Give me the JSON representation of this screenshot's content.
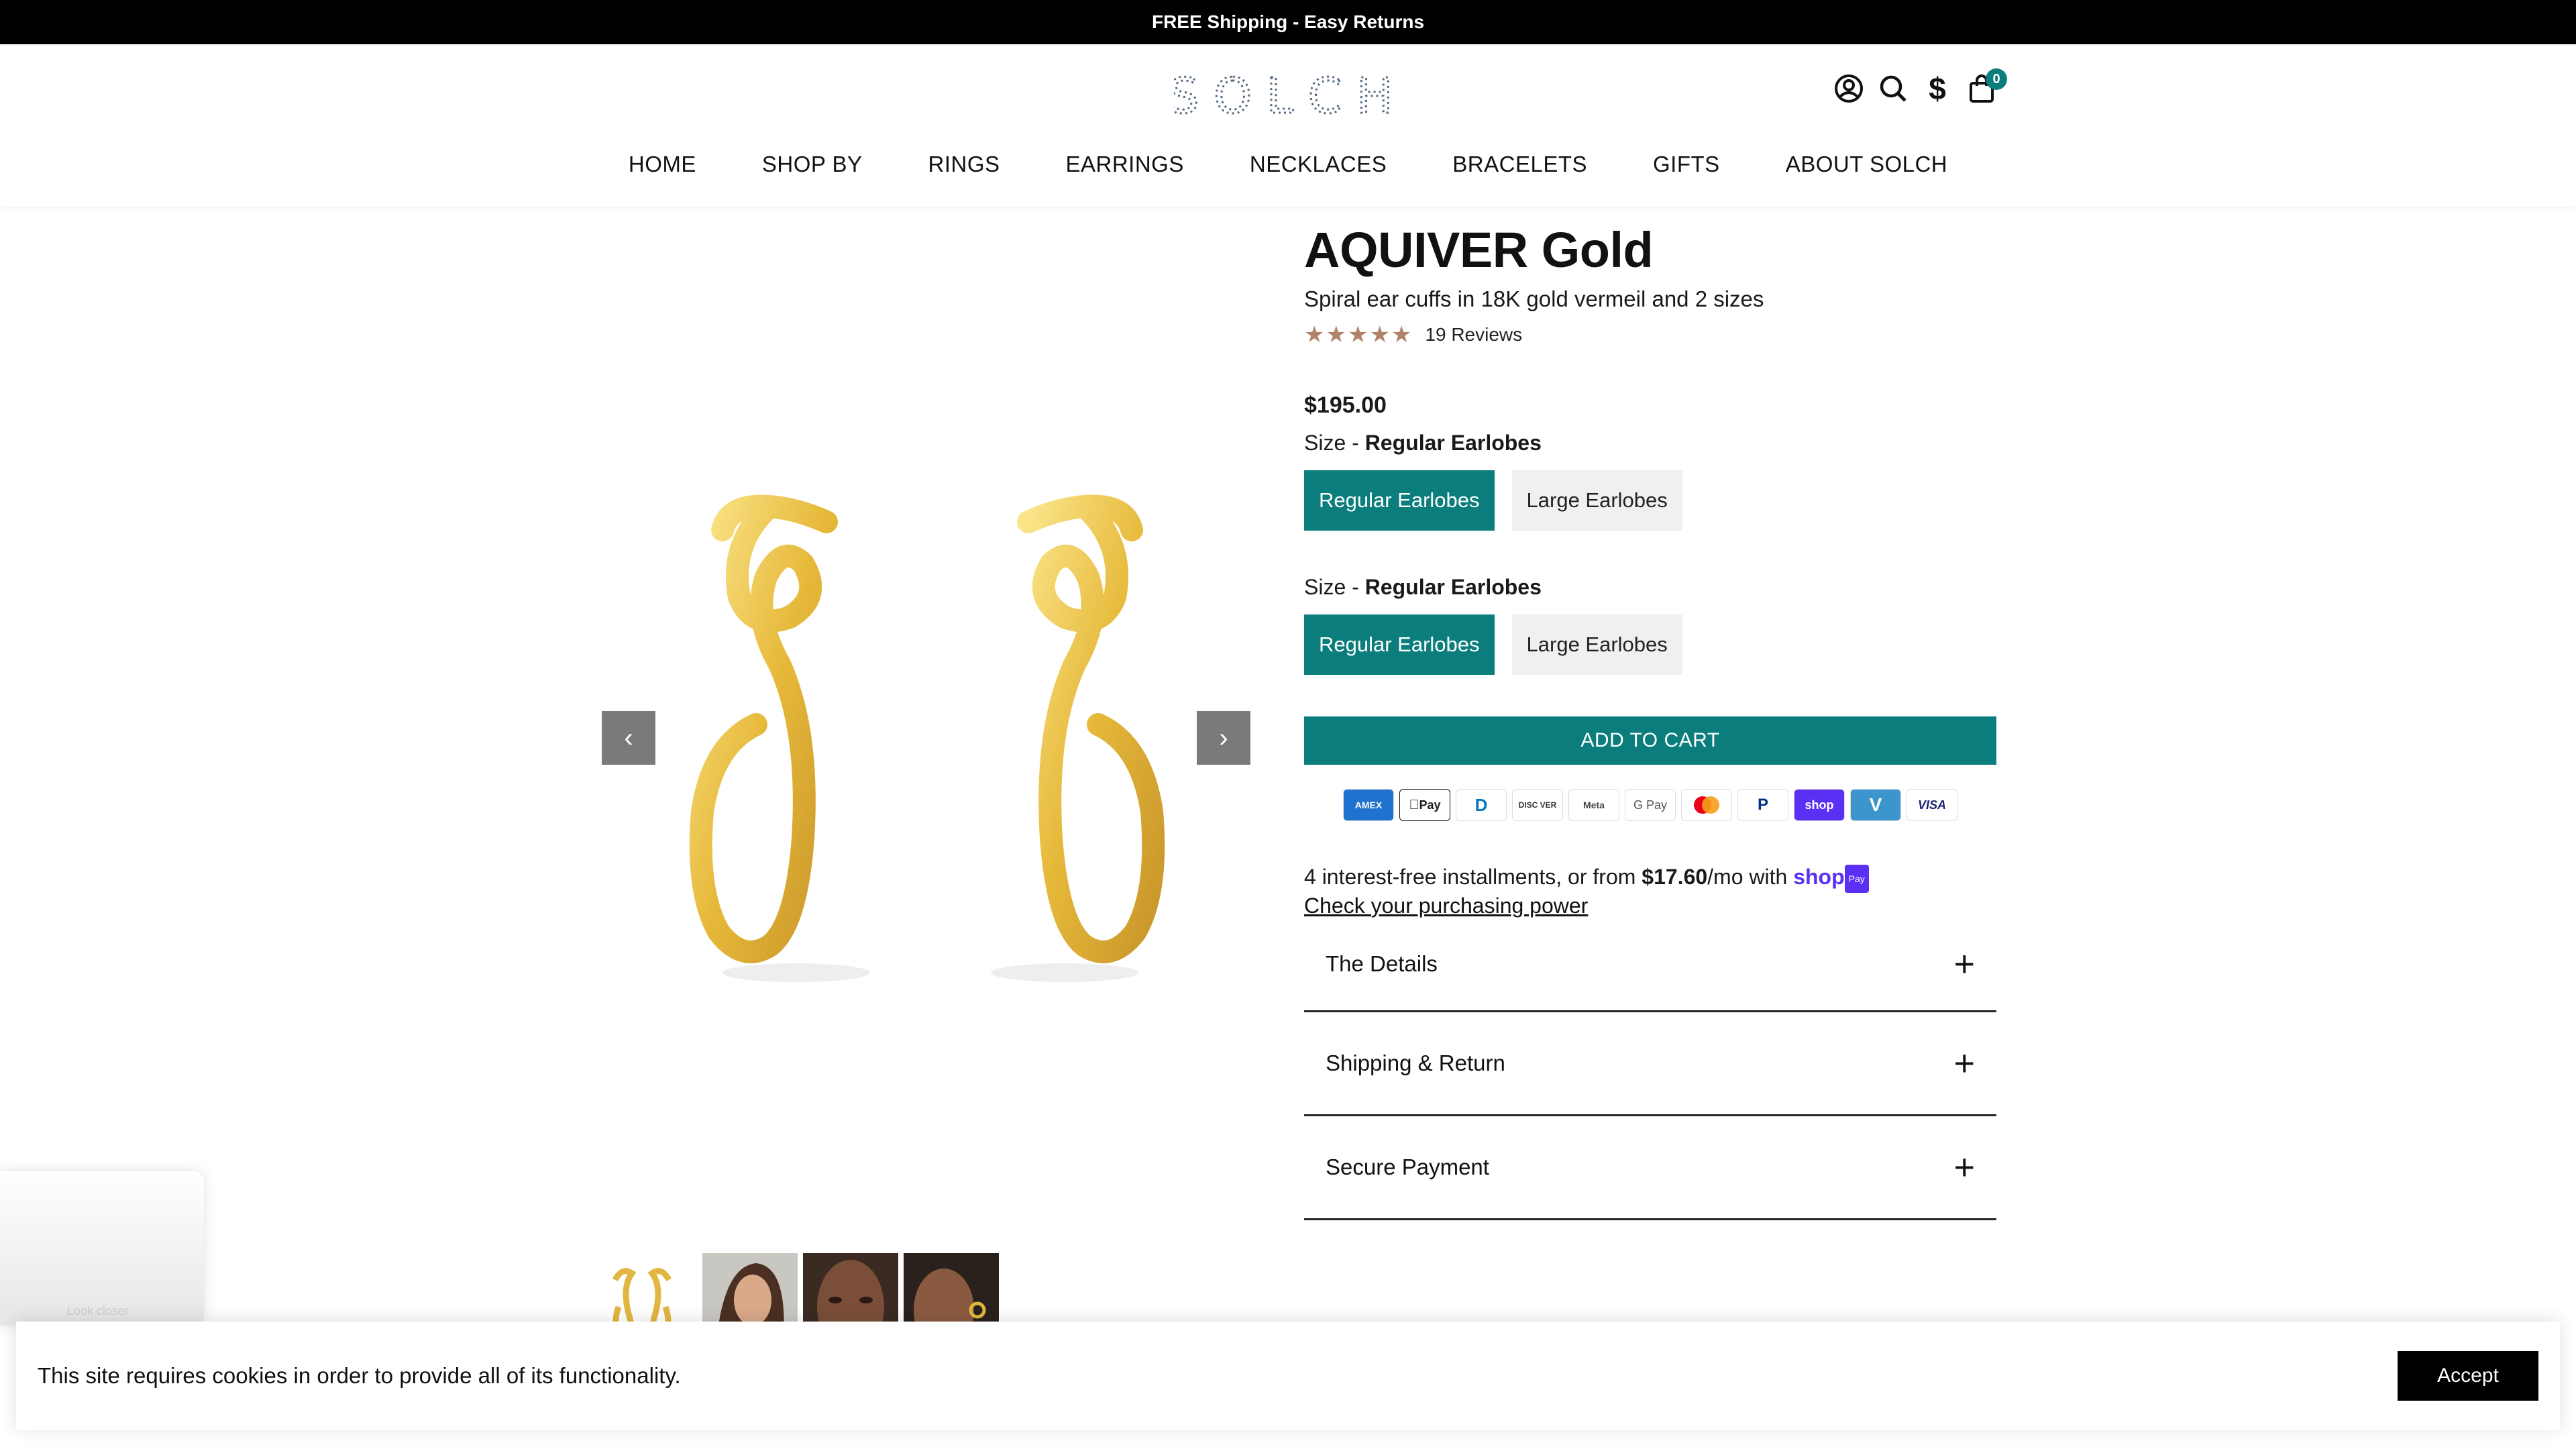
{
  "announcement": "FREE Shipping - Easy Returns",
  "brand": {
    "logo_text": "SOLCH"
  },
  "header_icons": {
    "account": "account-icon",
    "search": "search-icon",
    "currency_symbol": "$",
    "cart_count": "0"
  },
  "nav": [
    "HOME",
    "SHOP BY",
    "RINGS",
    "EARRINGS",
    "NECKLACES",
    "BRACELETS",
    "GIFTS",
    "ABOUT SOLCH"
  ],
  "gallery": {
    "prev_arrow": "‹",
    "next_arrow": "›"
  },
  "product": {
    "title": "AQUIVER Gold",
    "subtitle": "Spiral ear cuffs in 18K gold vermeil and 2 sizes",
    "stars": "★★★★★",
    "rating_value": 5,
    "reviews": "19 Reviews",
    "price": "$195.00"
  },
  "size_groups": [
    {
      "label": "Size",
      "separator": " - ",
      "selected": "Regular Earlobes",
      "options": [
        "Regular Earlobes",
        "Large Earlobes"
      ]
    },
    {
      "label": "Size",
      "separator": " - ",
      "selected": "Regular Earlobes",
      "options": [
        "Regular Earlobes",
        "Large Earlobes"
      ]
    }
  ],
  "add_to_cart": "ADD TO CART",
  "payment_methods": [
    "AMEX",
    "Pay",
    "D",
    "DISC VER",
    "Meta",
    "G Pay",
    "",
    "P",
    "shop",
    "V",
    "VISA"
  ],
  "installments": {
    "prefix": "4 interest-free installments, or from ",
    "amount": "$17.60",
    "suffix": "/mo with ",
    "shop": "shop",
    "pay_badge": "Pay",
    "link": "Check your purchasing power"
  },
  "accordions": [
    "The Details",
    "Shipping & Return",
    "Secure Payment"
  ],
  "accordion_icon": "+",
  "look_closer": "Look closer",
  "cookie": {
    "text": "This site requires cookies in order to provide all of its functionality.",
    "accept": "Accept"
  },
  "colors": {
    "accent": "#0b7d7c",
    "announcement_bg": "#000000",
    "stars": "#b0836a",
    "gold": "#e9c24a"
  }
}
